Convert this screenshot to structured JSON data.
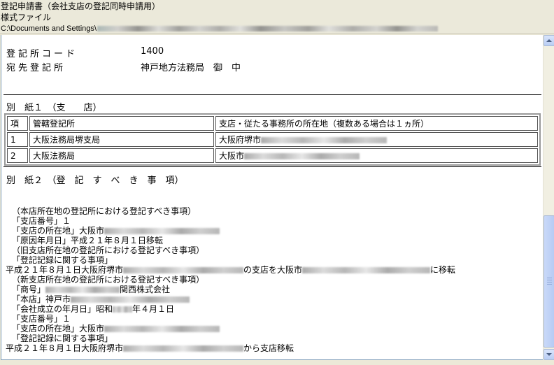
{
  "header": {
    "title": "登記申請書（会社支店の登記同時申請用）",
    "subtitle": "様式ファイル",
    "path_prefix": "C:\\Documents and Settings\\"
  },
  "office": {
    "code_label": "登記所コード",
    "code_value": "1400",
    "dest_label": "宛先登記所",
    "dest_value": "神戸地方法務局　御　中"
  },
  "annex1": {
    "title": "別　紙１　（支　　店）",
    "table": {
      "headers": [
        "項",
        "管轄登記所",
        "支店・従たる事務所の所在地（複数ある場合は１ヵ所）"
      ],
      "rows": [
        {
          "no": "1",
          "office": "大阪法務局堺支局",
          "address": "大阪府堺市"
        },
        {
          "no": "2",
          "office": "大阪法務局",
          "address": "大阪市"
        }
      ]
    }
  },
  "annex2": {
    "title": "別　紙２　（登　記　す　べ　き　事　項）",
    "lines": [
      "（本店所在地の登記所における登記すべき事項）",
      "「支店番号」１",
      "「支店の所在地」大阪市",
      "「原因年月日」平成２１年８月１日移転",
      "（旧支店所在地の登記所における登記すべき事項）",
      "「登記記録に関する事項」",
      "平成２１年８月１日大阪府堺市",
      "の支店を大阪市",
      "に移転",
      "（新支店所在地の登記所における登記すべき事項）",
      "「商号」",
      "関西株式会社",
      "「本店」神戸市",
      "「会社成立の年月日」昭和",
      "年４月１日",
      "「支店番号」１",
      "「支店の所在地」大阪市",
      "「登記記録に関する事項」",
      "平成２１年８月１日大阪府堺市",
      "から支店移転"
    ]
  }
}
